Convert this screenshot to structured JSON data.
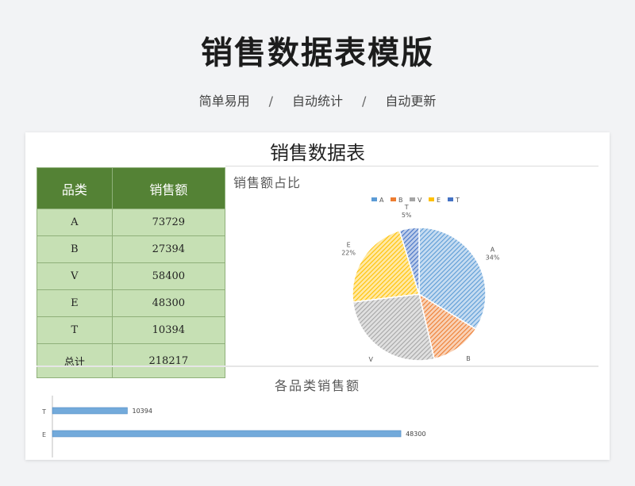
{
  "header": {
    "title": "销售数据表模版",
    "subtitle_items": [
      "简单易用",
      "自动统计",
      "自动更新"
    ],
    "separator": "/"
  },
  "sheet": {
    "title": "销售数据表",
    "table": {
      "headers": [
        "品类",
        "销售额"
      ],
      "rows": [
        {
          "category": "A",
          "sales": "73729"
        },
        {
          "category": "B",
          "sales": "27394"
        },
        {
          "category": "V",
          "sales": "58400"
        },
        {
          "category": "E",
          "sales": "48300"
        },
        {
          "category": "T",
          "sales": "10394"
        }
      ],
      "total": {
        "label": "总计",
        "value": "218217"
      }
    }
  },
  "chart_data": [
    {
      "type": "pie",
      "title": "销售额占比",
      "categories": [
        "A",
        "B",
        "V",
        "E",
        "T"
      ],
      "values": [
        73729,
        27394,
        58400,
        48300,
        10394
      ],
      "percent_labels": [
        "34%",
        "12%",
        "27%",
        "22%",
        "5%"
      ],
      "colors": [
        "#5b9bd5",
        "#ed7d31",
        "#a5a5a5",
        "#ffc000",
        "#4472c4"
      ],
      "legend": "top",
      "pattern": "diagonal-stripes"
    },
    {
      "type": "bar",
      "orientation": "horizontal",
      "title": "各品类销售额",
      "categories": [
        "T",
        "E"
      ],
      "values": [
        10394,
        48300
      ],
      "data_labels": [
        "10394",
        "48300"
      ],
      "color": "#5b9bd5"
    }
  ]
}
